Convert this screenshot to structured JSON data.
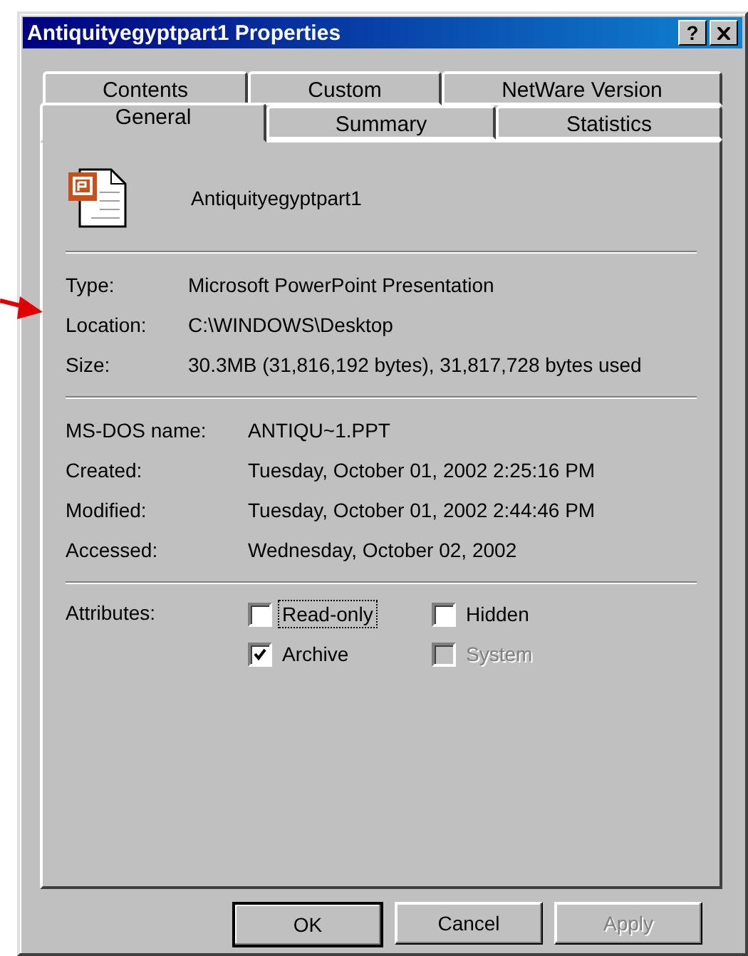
{
  "window": {
    "title": "Antiquityegyptpart1 Properties",
    "help_button": "?"
  },
  "tab_rows": [
    [
      {
        "label": "Contents",
        "selected": false
      },
      {
        "label": "Custom",
        "selected": false
      },
      {
        "label": "NetWare Version",
        "selected": false
      }
    ],
    [
      {
        "label": "General",
        "selected": true
      },
      {
        "label": "Summary",
        "selected": false
      },
      {
        "label": "Statistics",
        "selected": false
      }
    ]
  ],
  "file": {
    "name": "Antiquityegyptpart1"
  },
  "groups": [
    [
      {
        "label": "Type:",
        "value": "Microsoft PowerPoint Presentation"
      },
      {
        "label": "Location:",
        "value": "C:\\WINDOWS\\Desktop"
      },
      {
        "label": "Size:",
        "value": "30.3MB (31,816,192 bytes), 31,817,728 bytes used"
      }
    ],
    [
      {
        "label": "MS-DOS name:",
        "value": "ANTIQU~1.PPT"
      },
      {
        "label": "Created:",
        "value": "Tuesday, October 01, 2002 2:25:16 PM"
      },
      {
        "label": "Modified:",
        "value": "Tuesday, October 01, 2002 2:44:46 PM"
      },
      {
        "label": "Accessed:",
        "value": "Wednesday, October 02, 2002"
      }
    ]
  ],
  "attributes": {
    "label": "Attributes:",
    "items": [
      {
        "label": "Read-only",
        "checked": false,
        "disabled": false,
        "focused": true
      },
      {
        "label": "Hidden",
        "checked": false,
        "disabled": false,
        "focused": false
      },
      {
        "label": "Archive",
        "checked": true,
        "disabled": false,
        "focused": false
      },
      {
        "label": "System",
        "checked": false,
        "disabled": true,
        "focused": false
      }
    ]
  },
  "buttons": [
    {
      "label": "OK",
      "default": true,
      "disabled": false
    },
    {
      "label": "Cancel",
      "default": false,
      "disabled": false
    },
    {
      "label": "Apply",
      "default": false,
      "disabled": true
    }
  ]
}
